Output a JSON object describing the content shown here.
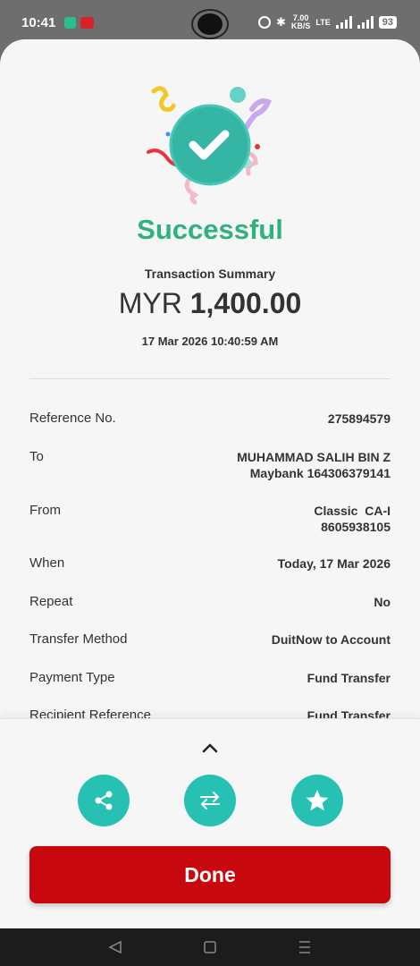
{
  "status_bar": {
    "time": "10:41",
    "speed": "7.00",
    "speed_unit": "KB/S",
    "network": "LTE",
    "battery": "93"
  },
  "result": {
    "title": "Successful",
    "summary_label": "Transaction Summary",
    "currency": "MYR",
    "amount": "1,400.00",
    "datetime": "17 Mar 2026 10:40:59 AM"
  },
  "details": [
    {
      "label": "Reference No.",
      "value": "275894579"
    },
    {
      "label": "To",
      "value": "MUHAMMAD SALIH BIN Z",
      "value2": "Maybank 164306379141"
    },
    {
      "label": "From",
      "value": "Classic  CA-I",
      "value2": "8605938105"
    },
    {
      "label": "When",
      "value": "Today, 17 Mar 2026"
    },
    {
      "label": "Repeat",
      "value": "No"
    },
    {
      "label": "Transfer Method",
      "value": "DuitNow to Account"
    },
    {
      "label": "Payment Type",
      "value": "Fund Transfer"
    },
    {
      "label": "Recipient Reference",
      "value": "Fund Transfer"
    }
  ],
  "actions": {
    "share_icon": "share-icon",
    "transfer_icon": "transfer-icon",
    "favourite_icon": "star-icon",
    "done_label": "Done"
  },
  "colors": {
    "success": "#2fb37d",
    "accent_teal": "#27c1b4",
    "done_red": "#c8080f"
  }
}
